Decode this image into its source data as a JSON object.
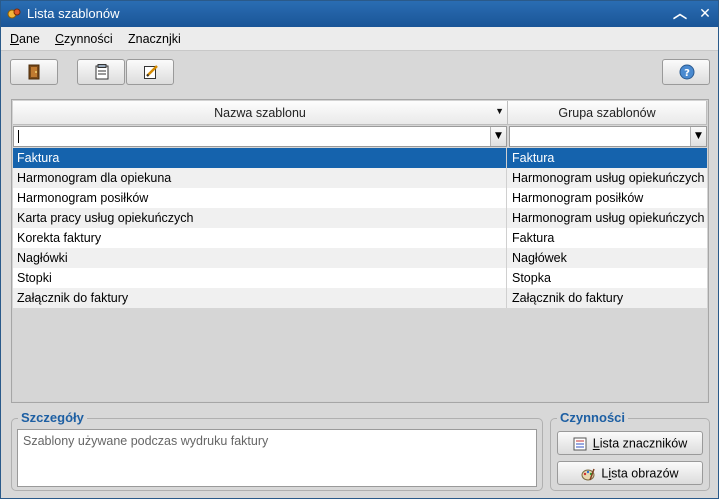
{
  "window": {
    "title": "Lista szablonów"
  },
  "menu": [
    {
      "accel": "D",
      "rest": "ane"
    },
    {
      "accel": "C",
      "rest": "zynności"
    },
    {
      "accel": "",
      "rest": "Znacznjki"
    }
  ],
  "toolbar": {
    "buttons": [
      "exit-door-icon",
      "template-list-icon",
      "edit-icon"
    ],
    "help": "help-icon"
  },
  "grid": {
    "columns": [
      "Nazwa szablonu",
      "Grupa szablonów"
    ],
    "filters": {
      "name": "",
      "group": ""
    },
    "rows": [
      {
        "name": "Faktura",
        "group": "Faktura",
        "selected": true
      },
      {
        "name": "Harmonogram dla opiekuna",
        "group": "Harmonogram usług opiekuńczych"
      },
      {
        "name": "Harmonogram posiłków",
        "group": "Harmonogram posiłków"
      },
      {
        "name": "Karta pracy usług opiekuńczych",
        "group": "Harmonogram usług opiekuńczych"
      },
      {
        "name": "Korekta faktury",
        "group": "Faktura"
      },
      {
        "name": "Nagłówki",
        "group": "Nagłówek"
      },
      {
        "name": "Stopki",
        "group": "Stopka"
      },
      {
        "name": "Załącznik do faktury",
        "group": "Załącznik do faktury"
      }
    ]
  },
  "details": {
    "title": "Szczegóły",
    "text": "Szablony używane podczas wydruku faktury"
  },
  "actions": {
    "title": "Czynności",
    "markers_accel": "L",
    "markers_rest": "ista znaczników",
    "images_prefix": "L",
    "images_accel": "i",
    "images_rest": "sta obrazów"
  },
  "colors": {
    "titlebar": "#1a5597",
    "selection": "#1563ad",
    "group_title": "#1d5fa3"
  }
}
